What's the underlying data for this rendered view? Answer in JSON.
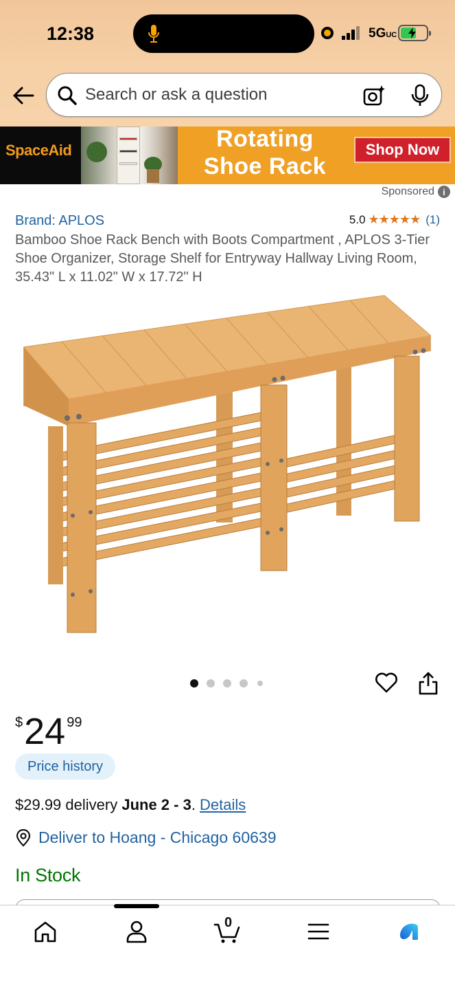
{
  "status_bar": {
    "time": "12:38",
    "network": "5G",
    "network_suffix": "UC"
  },
  "header": {
    "search_placeholder": "Search or ask a question"
  },
  "banner": {
    "brand": "SpaceAid",
    "headline_line1": "Rotating",
    "headline_line2": "Shoe Rack",
    "cta": "Shop Now"
  },
  "sponsored_label": "Sponsored",
  "product": {
    "brand_link": "Brand: APLOS",
    "rating": "5.0",
    "rating_stars": "★★★★★",
    "rating_count": "(1)",
    "title": "Bamboo Shoe Rack Bench with Boots Compartment , APLOS 3-Tier Shoe Organizer, Storage Shelf for Entryway Hallway Living Room, 35.43\" L x 11.02\" W x 17.72\" H",
    "image_count": 5,
    "image_index": 1,
    "price_currency": "$",
    "price_whole": "24",
    "price_fraction": "99",
    "price_history_label": "Price history",
    "delivery_price": "$29.99 delivery ",
    "delivery_dates": "June 2 - 3",
    "delivery_period": ". ",
    "details_link": "Details",
    "deliver_to": "Deliver to Hoang - Chicago 60639",
    "stock_status": "In Stock"
  },
  "tabbar": {
    "items": [
      "home-icon",
      "account-icon",
      "cart-icon",
      "menu-icon",
      "rufus-icon"
    ],
    "cart_count": "0"
  },
  "colors": {
    "header_bg": "#f6d0a6",
    "link": "#2162a1",
    "in_stock": "#007600",
    "star": "#de7921",
    "banner_bg": "#efa025",
    "cta_bg": "#d0202b"
  }
}
